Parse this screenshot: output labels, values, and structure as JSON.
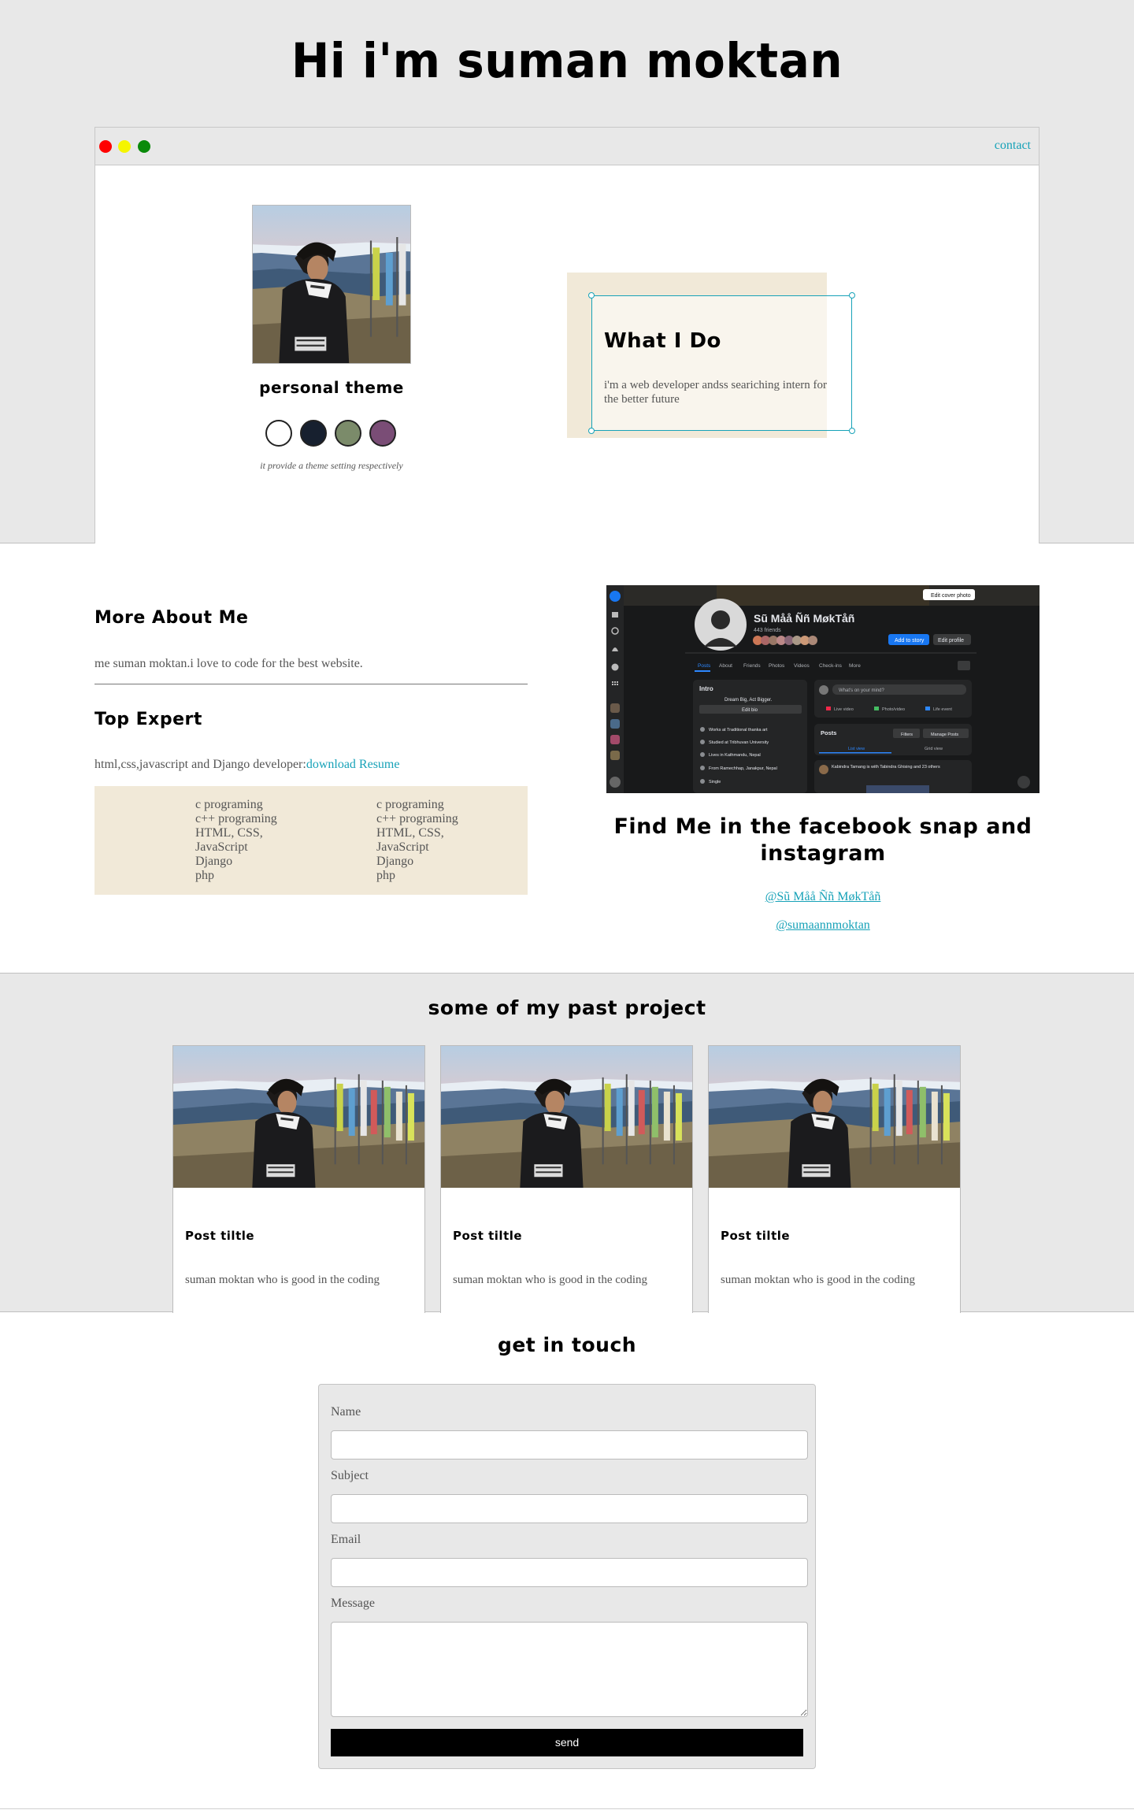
{
  "hero": {
    "title": "Hi i'm suman moktan"
  },
  "window": {
    "contact_label": "contact"
  },
  "theme": {
    "title": "personal theme",
    "note": "it provide a theme setting respectively",
    "swatches": [
      "#ffffff",
      "#17202f",
      "#7b8b6a",
      "#7a4d76"
    ]
  },
  "what_i_do": {
    "title": "What I Do",
    "text": "i'm a web developer andss seariching intern for the better future"
  },
  "about": {
    "title": "More About Me",
    "text": "me suman moktan.i love to code for the best website."
  },
  "expert": {
    "title": "Top Expert",
    "text": "html,css,javascript and Django developer:",
    "resume_link": "download Resume",
    "skills_left": [
      "c programing",
      "c++ programing",
      "HTML, CSS,",
      "JavaScript",
      "Django",
      "php"
    ],
    "skills_right": [
      "c programing",
      "c++ programing",
      "HTML, CSS,",
      "JavaScript",
      "Django",
      "php"
    ]
  },
  "facebook_shot": {
    "name": "Sũ Måå Ññ MøkTåñ",
    "friends": "443 friends",
    "edit_cover": "Edit cover photo",
    "add_story": "Add to story",
    "edit_profile": "Edit profile",
    "tabs": [
      "Posts",
      "About",
      "Friends",
      "Photos",
      "Videos",
      "Check-ins",
      "More"
    ],
    "intro_title": "Intro",
    "intro_bio": "Dream Big, Act Bigger.",
    "edit_bio": "Edit bio",
    "intro_items": [
      "Works at Traditional thanka art",
      "Studied at Tribhuvan University",
      "Lives in Kathmandu, Nepal",
      "From Ramechhap, Janakpur, Nepal",
      "Single"
    ],
    "mind_placeholder": "What's on your mind?",
    "post_actions": [
      "Live video",
      "Photo/video",
      "Life event"
    ],
    "posts_title": "Posts",
    "filters": "Filters",
    "manage_posts": "Manage Posts",
    "list_view": "List view",
    "grid_view": "Grid view",
    "post_text": "Kabindra Tamang is with Tabindra Ghising and 23 others"
  },
  "socials": {
    "title": "Find Me in the facebook snap and instagram",
    "facebook": "@Sũ Måå Ññ MøkTåñ",
    "instagram": "@sumaannmoktan"
  },
  "projects": {
    "title": "some of my past project",
    "cards": [
      {
        "title": "Post tiltle",
        "text": "suman moktan who is good in the coding"
      },
      {
        "title": "Post tiltle",
        "text": "suman moktan who is good in the coding"
      },
      {
        "title": "Post tiltle",
        "text": "suman moktan who is good in the coding"
      }
    ]
  },
  "contact": {
    "title": "get in touch",
    "name_label": "Name",
    "subject_label": "Subject",
    "email_label": "Email",
    "message_label": "Message",
    "send_label": "send"
  }
}
